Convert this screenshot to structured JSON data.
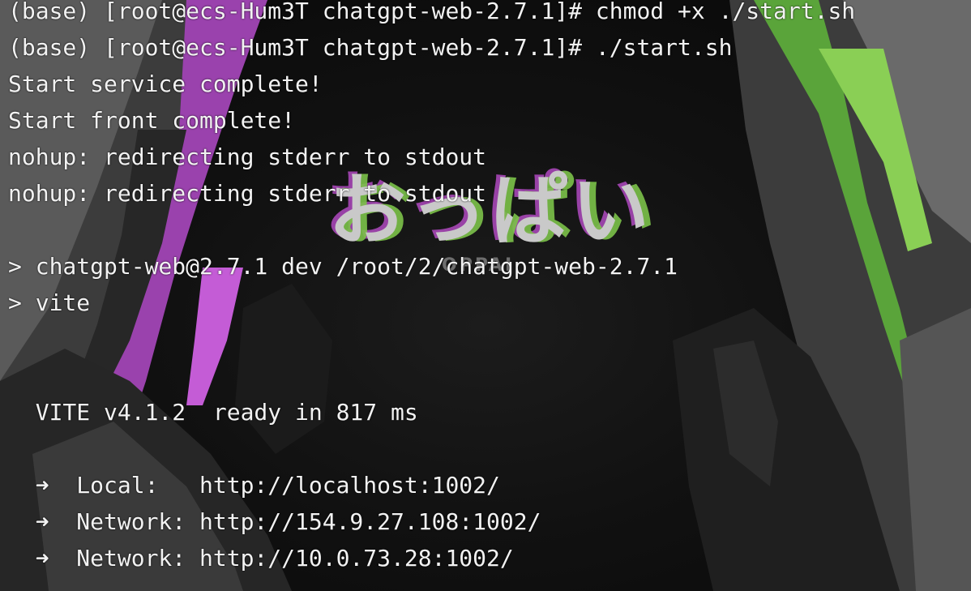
{
  "terminal": {
    "lines": [
      "(base) [root@ecs-Hum3T chatgpt-web-2.7.1]# chmod +x ./start.sh",
      "(base) [root@ecs-Hum3T chatgpt-web-2.7.1]# ./start.sh",
      "Start service complete!",
      "Start front complete!",
      "nohup: redirecting stderr to stdout",
      "nohup: redirecting stderr to stdout",
      "",
      "> chatgpt-web@2.7.1 dev /root/2/chatgpt-web-2.7.1",
      "> vite",
      "",
      "",
      "  VITE v4.1.2  ready in 817 ms",
      "",
      "  ➜  Local:   http://localhost:1002/",
      "  ➜  Network: http://154.9.27.108:1002/",
      "  ➜  Network: http://10.0.73.28:1002/"
    ]
  },
  "wallpaper": {
    "title": "おっぱい",
    "subtitle": "OPPAI",
    "accent_purple": "#b04ac0",
    "accent_green": "#7cc24a",
    "background": "#0c0c0c"
  }
}
